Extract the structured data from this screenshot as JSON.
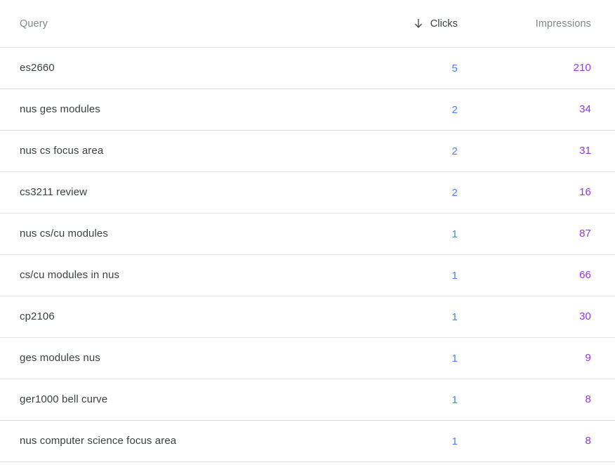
{
  "table": {
    "sort": {
      "column": "Clicks",
      "direction": "descending",
      "arrow_icon": "arrow-down-icon"
    },
    "columns": {
      "query": "Query",
      "clicks": "Clicks",
      "impressions": "Impressions"
    },
    "colors": {
      "clicks_value": "#4285f4",
      "impressions_value": "#9334e6",
      "header_text": "#80868b",
      "active_header_text": "#3c4043",
      "row_text": "#3c4043",
      "divider": "#e3e3e3",
      "background": "#ffffff"
    },
    "rows": [
      {
        "query": "es2660",
        "clicks": "5",
        "impressions": "210"
      },
      {
        "query": "nus ges modules",
        "clicks": "2",
        "impressions": "34"
      },
      {
        "query": "nus cs focus area",
        "clicks": "2",
        "impressions": "31"
      },
      {
        "query": "cs3211 review",
        "clicks": "2",
        "impressions": "16"
      },
      {
        "query": "nus cs/cu modules",
        "clicks": "1",
        "impressions": "87"
      },
      {
        "query": "cs/cu modules in nus",
        "clicks": "1",
        "impressions": "66"
      },
      {
        "query": "cp2106",
        "clicks": "1",
        "impressions": "30"
      },
      {
        "query": "ges modules nus",
        "clicks": "1",
        "impressions": "9"
      },
      {
        "query": "ger1000 bell curve",
        "clicks": "1",
        "impressions": "8"
      },
      {
        "query": "nus computer science focus area",
        "clicks": "1",
        "impressions": "8"
      }
    ]
  }
}
